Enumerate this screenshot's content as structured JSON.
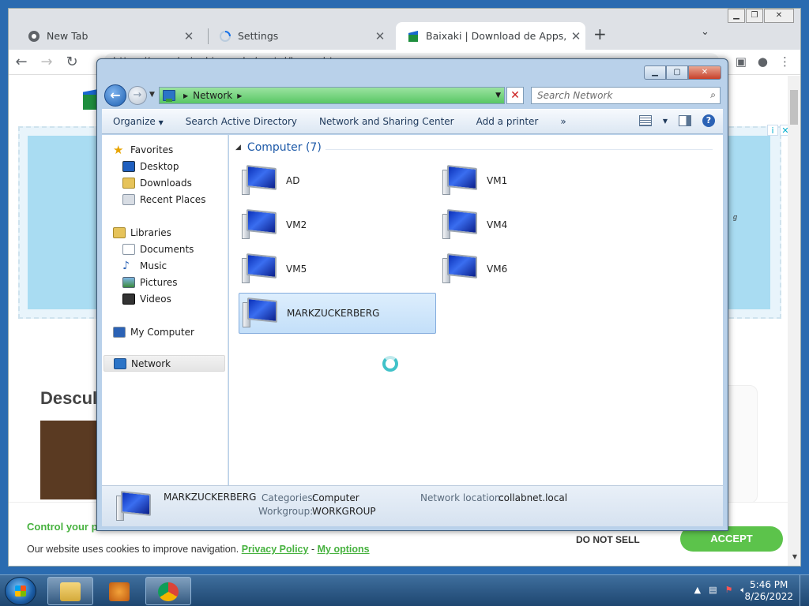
{
  "browser": {
    "tabs": [
      {
        "title": "New Tab"
      },
      {
        "title": "Settings"
      },
      {
        "title": "Baixaki | Download de Apps, Prog"
      }
    ],
    "url": "https://www.baixaki.com.br/portal/home.htm",
    "page": {
      "heading": "Descul",
      "cookie": {
        "title": "Control your p",
        "text": "Our website uses cookies to improve navigation.",
        "privacy_link": "Privacy Policy",
        "separator": "-",
        "options_link": "My options",
        "do_not_sell": "DO NOT SELL",
        "accept": "ACCEPT"
      }
    }
  },
  "explorer": {
    "address_segment": "Network",
    "search_placeholder": "Search Network",
    "commands": [
      "Organize",
      "Search Active Directory",
      "Network and Sharing Center",
      "Add a printer"
    ],
    "more_label": "»",
    "nav": {
      "favorites": {
        "label": "Favorites",
        "items": [
          "Desktop",
          "Downloads",
          "Recent Places"
        ]
      },
      "libraries": {
        "label": "Libraries",
        "items": [
          "Documents",
          "Music",
          "Pictures",
          "Videos"
        ]
      },
      "my_computer": "My Computer",
      "network": "Network"
    },
    "group_title": "Computer (7)",
    "computers": [
      "AD",
      "VM1",
      "VM2",
      "VM4",
      "VM5",
      "VM6",
      "MARKZUCKERBERG"
    ],
    "selected_computer": "MARKZUCKERBERG",
    "details": {
      "name": "MARKZUCKERBERG",
      "categories_label": "Categories:",
      "categories_value": "Computer",
      "workgroup_label": "Workgroup:",
      "workgroup_value": "WORKGROUP",
      "network_location_label": "Network location:",
      "network_location_value": "collabnet.local"
    }
  },
  "taskbar": {
    "time": "5:46 PM",
    "date": "8/26/2022"
  }
}
